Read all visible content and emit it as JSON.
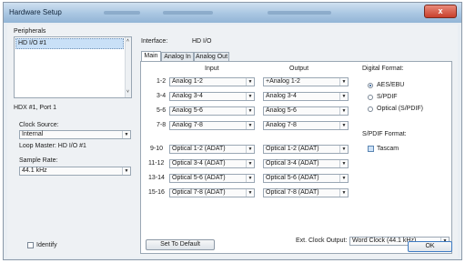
{
  "window": {
    "title": "Hardware Setup",
    "close_glyph": "x"
  },
  "left": {
    "peripherals_label": "Peripherals",
    "peripherals_items": [
      "HD I/O #1"
    ],
    "port_label": "HDX #1, Port 1",
    "clock_source_label": "Clock Source:",
    "clock_source_value": "Internal",
    "loop_master": "Loop Master: HD I/O #1",
    "sample_rate_label": "Sample Rate:",
    "sample_rate_value": "44.1 kHz",
    "identify_label": "Identify"
  },
  "interface": {
    "label": "Interface:",
    "value": "HD I/O"
  },
  "tabs": [
    {
      "label": "Main",
      "active": true
    },
    {
      "label": "Analog In",
      "active": false
    },
    {
      "label": "Analog Out",
      "active": false
    }
  ],
  "io": {
    "input_header": "Input",
    "output_header": "Output",
    "rows": [
      {
        "ch": "1-2",
        "input": "Analog 1-2",
        "output": "+Analog 1-2"
      },
      {
        "ch": "3-4",
        "input": "Analog 3-4",
        "output": "Analog 3-4"
      },
      {
        "ch": "5-6",
        "input": "Analog 5-6",
        "output": "Analog 5-6"
      },
      {
        "ch": "7-8",
        "input": "Analog 7-8",
        "output": "Analog 7-8"
      },
      {
        "ch": "9-10",
        "input": "Optical 1-2 (ADAT)",
        "output": "Optical 1-2 (ADAT)"
      },
      {
        "ch": "11-12",
        "input": "Optical 3-4 (ADAT)",
        "output": "Optical 3-4 (ADAT)"
      },
      {
        "ch": "13-14",
        "input": "Optical 5-6 (ADAT)",
        "output": "Optical 5-6 (ADAT)"
      },
      {
        "ch": "15-16",
        "input": "Optical 7-8 (ADAT)",
        "output": "Optical 7-8 (ADAT)"
      }
    ]
  },
  "digital_format": {
    "label": "Digital Format:",
    "options": [
      {
        "label": "AES/EBU",
        "selected": true
      },
      {
        "label": "S/PDIF",
        "selected": false
      },
      {
        "label": "Optical (S/PDIF)",
        "selected": false
      }
    ]
  },
  "spdif_format": {
    "label": "S/PDIF Format:",
    "tascam_label": "Tascam"
  },
  "ext_clock": {
    "label": "Ext. Clock Output:",
    "value": "Word Clock (44.1 kHz)"
  },
  "buttons": {
    "set_default": "Set To Default",
    "ok": "OK"
  }
}
